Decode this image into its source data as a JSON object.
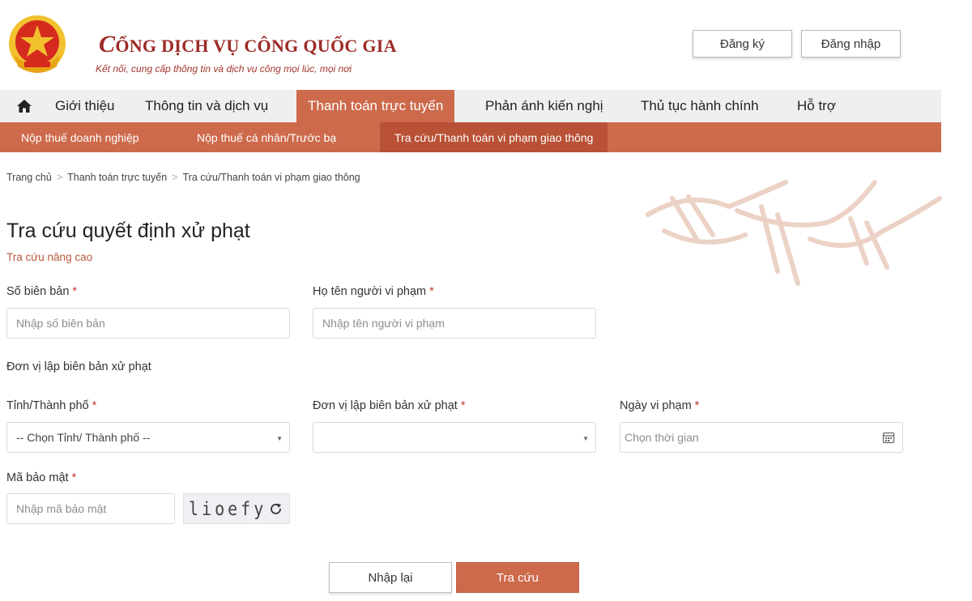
{
  "header": {
    "title_first": "C",
    "title_rest": "ỔNG DỊCH VỤ CÔNG QUỐC GIA",
    "subtitle": "Kết nối, cung cấp thông tin và dịch vụ công mọi lúc, mọi nơi",
    "register_label": "Đăng ký",
    "login_label": "Đăng nhập"
  },
  "main_nav": {
    "items": [
      {
        "label": "Giới thiệu"
      },
      {
        "label": "Thông tin và dịch vụ"
      },
      {
        "label": "Thanh toán trực tuyến",
        "active": true
      },
      {
        "label": "Phản ánh kiến nghị"
      },
      {
        "label": "Thủ tục hành chính"
      },
      {
        "label": "Hỗ trợ"
      }
    ]
  },
  "sub_nav": {
    "items": [
      {
        "label": "Nộp thuế doanh nghiệp"
      },
      {
        "label": "Nộp thuế cá nhân/Trước bạ"
      },
      {
        "label": "Tra cứu/Thanh toán vi phạm giao thông",
        "active": true
      }
    ]
  },
  "breadcrumb": [
    "Trang chủ",
    "Thanh toán trực tuyến",
    "Tra cứu/Thanh toán vi phạm giao thông"
  ],
  "breadcrumb_sep": ">",
  "form": {
    "title": "Tra cứu quyết định xử phạt",
    "advanced_link": "Tra cứu nâng cao",
    "required_mark": "*",
    "record_number": {
      "label": "Số biên bản",
      "placeholder": "Nhập số biên bản"
    },
    "violator_name": {
      "label": "Họ tên người vi phạm",
      "placeholder": "Nhập tên người vi phạm"
    },
    "section_label": "Đơn vị lập biên bản xử phạt",
    "province": {
      "label": "Tỉnh/Thành phố",
      "selected": "-- Chọn Tỉnh/ Thành phố --"
    },
    "issuing_unit": {
      "label": "Đơn vị lập biên bản xử phạt",
      "selected": ""
    },
    "violation_date": {
      "label": "Ngày vi phạm",
      "placeholder": "Chọn thời gian"
    },
    "captcha": {
      "label": "Mã bảo mật",
      "placeholder": "Nhập mã bảo mật",
      "code": "lioefy"
    },
    "reset_label": "Nhập lại",
    "submit_label": "Tra cứu"
  },
  "colors": {
    "accent": "#cd6a4c",
    "accent_dark": "#b85136",
    "brand_red": "#9c2a25",
    "emblem_red": "#d52b1e",
    "emblem_gold": "#f2c12e"
  }
}
